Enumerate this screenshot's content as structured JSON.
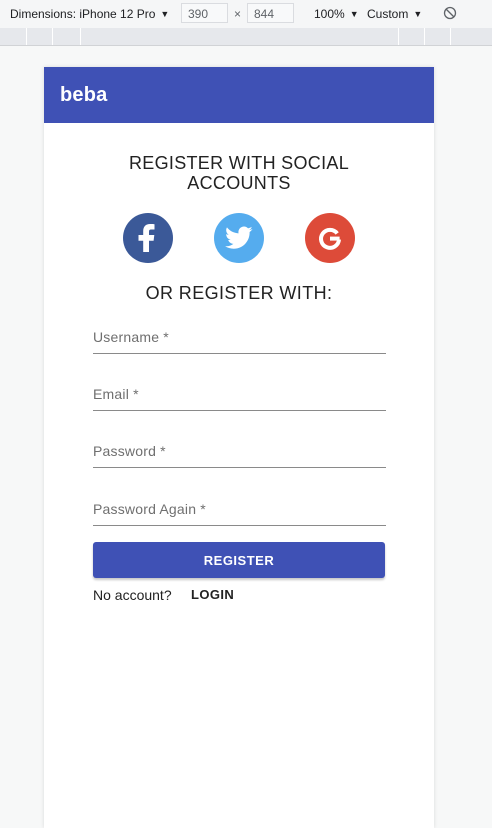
{
  "devtools": {
    "dimensions_label": "Dimensions: iPhone 12 Pro",
    "width": "390",
    "times": "×",
    "height": "844",
    "zoom": "100%",
    "throttle": "Custom"
  },
  "app": {
    "brand": "beba",
    "social_title": "REGISTER WITH SOCIAL ACCOUNTS",
    "or_title": "OR REGISTER WITH:",
    "social": [
      {
        "name": "facebook",
        "color": "#3b5998"
      },
      {
        "name": "twitter",
        "color": "#55acee"
      },
      {
        "name": "google",
        "color": "#dd4b39"
      }
    ],
    "fields": {
      "username_placeholder": "Username *",
      "email_placeholder": "Email *",
      "password_placeholder": "Password *",
      "password_again_placeholder": "Password Again *"
    },
    "register_label": "REGISTER",
    "no_account_text": "No account?",
    "login_label": "LOGIN",
    "accent_color": "#3f51b5"
  }
}
